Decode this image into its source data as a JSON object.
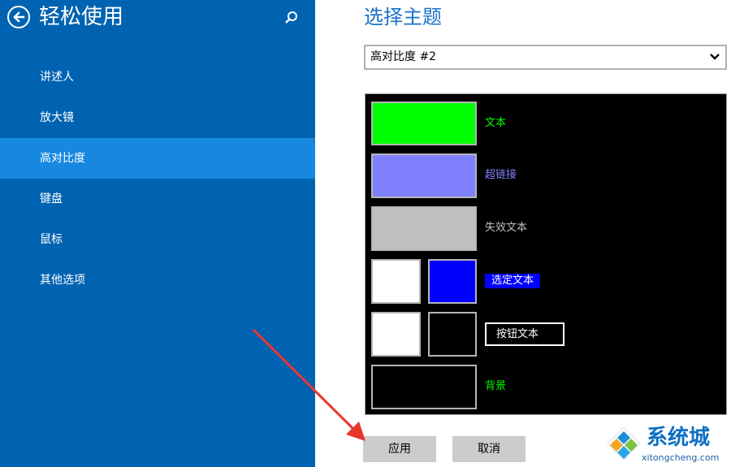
{
  "sidebar": {
    "title": "轻松使用",
    "back_icon": "back-arrow-icon",
    "search_icon": "search-icon",
    "items": [
      {
        "label": "讲述人",
        "selected": false
      },
      {
        "label": "放大镜",
        "selected": false
      },
      {
        "label": "高对比度",
        "selected": true
      },
      {
        "label": "键盘",
        "selected": false
      },
      {
        "label": "鼠标",
        "selected": false
      },
      {
        "label": "其他选项",
        "selected": false
      }
    ]
  },
  "main": {
    "heading": "选择主题",
    "theme_select": {
      "value": "高对比度 #2",
      "icon": "chevron-down-icon"
    },
    "preview": {
      "text_label": "文本",
      "hyperlink_label": "超链接",
      "disabled_text_label": "失效文本",
      "selected_text_label": "选定文本",
      "button_text_label": "按钮文本",
      "background_label": "背景"
    },
    "buttons": {
      "apply": "应用",
      "cancel": "取消"
    }
  },
  "watermark": {
    "title": "系统城",
    "url": "xitongcheng.com"
  },
  "colors": {
    "sidebar_bg": "#0063b1",
    "sidebar_selected": "#1688e0",
    "heading": "#1a73c9",
    "text_color": "#00ff00",
    "hyperlink_color": "#8080ff",
    "disabled_text_color": "#c0c0c0",
    "selected_text_bg": "#0000ff",
    "button_face": "#ffffff",
    "button_text": "#000000",
    "background": "#000000",
    "arrow": "#e8362c"
  }
}
